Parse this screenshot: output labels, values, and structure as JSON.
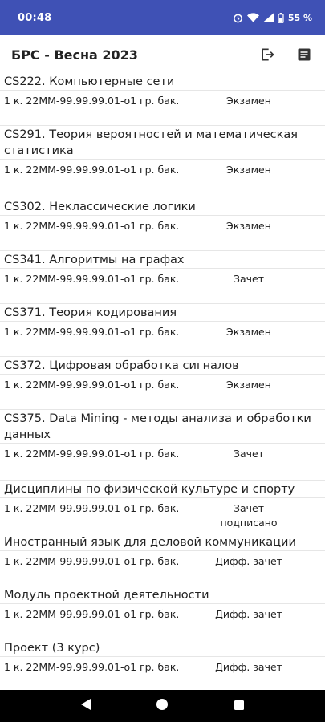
{
  "status_bar": {
    "time": "00:48",
    "battery": "55 %"
  },
  "app_bar": {
    "title": "БРС - Весна 2023"
  },
  "courses": [
    {
      "title": "CS222. Компьютерные сети",
      "group": "1 к. 22ММ-99.99.99.01-о1 гр. бак.",
      "exam": "Экзамен",
      "status": ""
    },
    {
      "title": "CS291. Теория вероятностей и математическая статистика",
      "group": "1 к. 22ММ-99.99.99.01-о1 гр. бак.",
      "exam": "Экзамен",
      "status": ""
    },
    {
      "title": "CS302. Неклассические логики",
      "group": "1 к. 22ММ-99.99.99.01-о1 гр. бак.",
      "exam": "Экзамен",
      "status": ""
    },
    {
      "title": "CS341. Алгоритмы на графах",
      "group": "1 к. 22ММ-99.99.99.01-о1 гр. бак.",
      "exam": "Зачет",
      "status": ""
    },
    {
      "title": "CS371. Теория кодирования",
      "group": "1 к. 22ММ-99.99.99.01-о1 гр. бак.",
      "exam": "Экзамен",
      "status": ""
    },
    {
      "title": "CS372. Цифровая обработка сигналов",
      "group": "1 к. 22ММ-99.99.99.01-о1 гр. бак.",
      "exam": "Экзамен",
      "status": ""
    },
    {
      "title": "CS375. Data Mining - методы анализа и обработки данных",
      "group": "1 к. 22ММ-99.99.99.01-о1 гр. бак.",
      "exam": "Зачет",
      "status": ""
    },
    {
      "title": "Дисциплины по физической культуре и спорту",
      "group": "1 к. 22ММ-99.99.99.01-о1 гр. бак.",
      "exam": "Зачет",
      "status": "подписано"
    },
    {
      "title": "Иностранный язык для деловой коммуникации",
      "group": "1 к. 22ММ-99.99.99.01-о1 гр. бак.",
      "exam": "Дифф. зачет",
      "status": ""
    },
    {
      "title": "Модуль проектной деятельности",
      "group": "1 к. 22ММ-99.99.99.01-о1 гр. бак.",
      "exam": "Дифф. зачет",
      "status": ""
    },
    {
      "title": "Проект (3 курс)",
      "group": "1 к. 22ММ-99.99.99.01-о1 гр. бак.",
      "exam": "Дифф. зачет",
      "status": ""
    }
  ],
  "icons": {
    "logout": "logout-icon",
    "report": "report-icon",
    "nav_back": "back-triangle-icon",
    "nav_home": "home-circle-icon",
    "nav_recents": "recents-square-icon"
  },
  "colors": {
    "status_bar": "#3f51b5",
    "nav_bar": "#000000"
  }
}
